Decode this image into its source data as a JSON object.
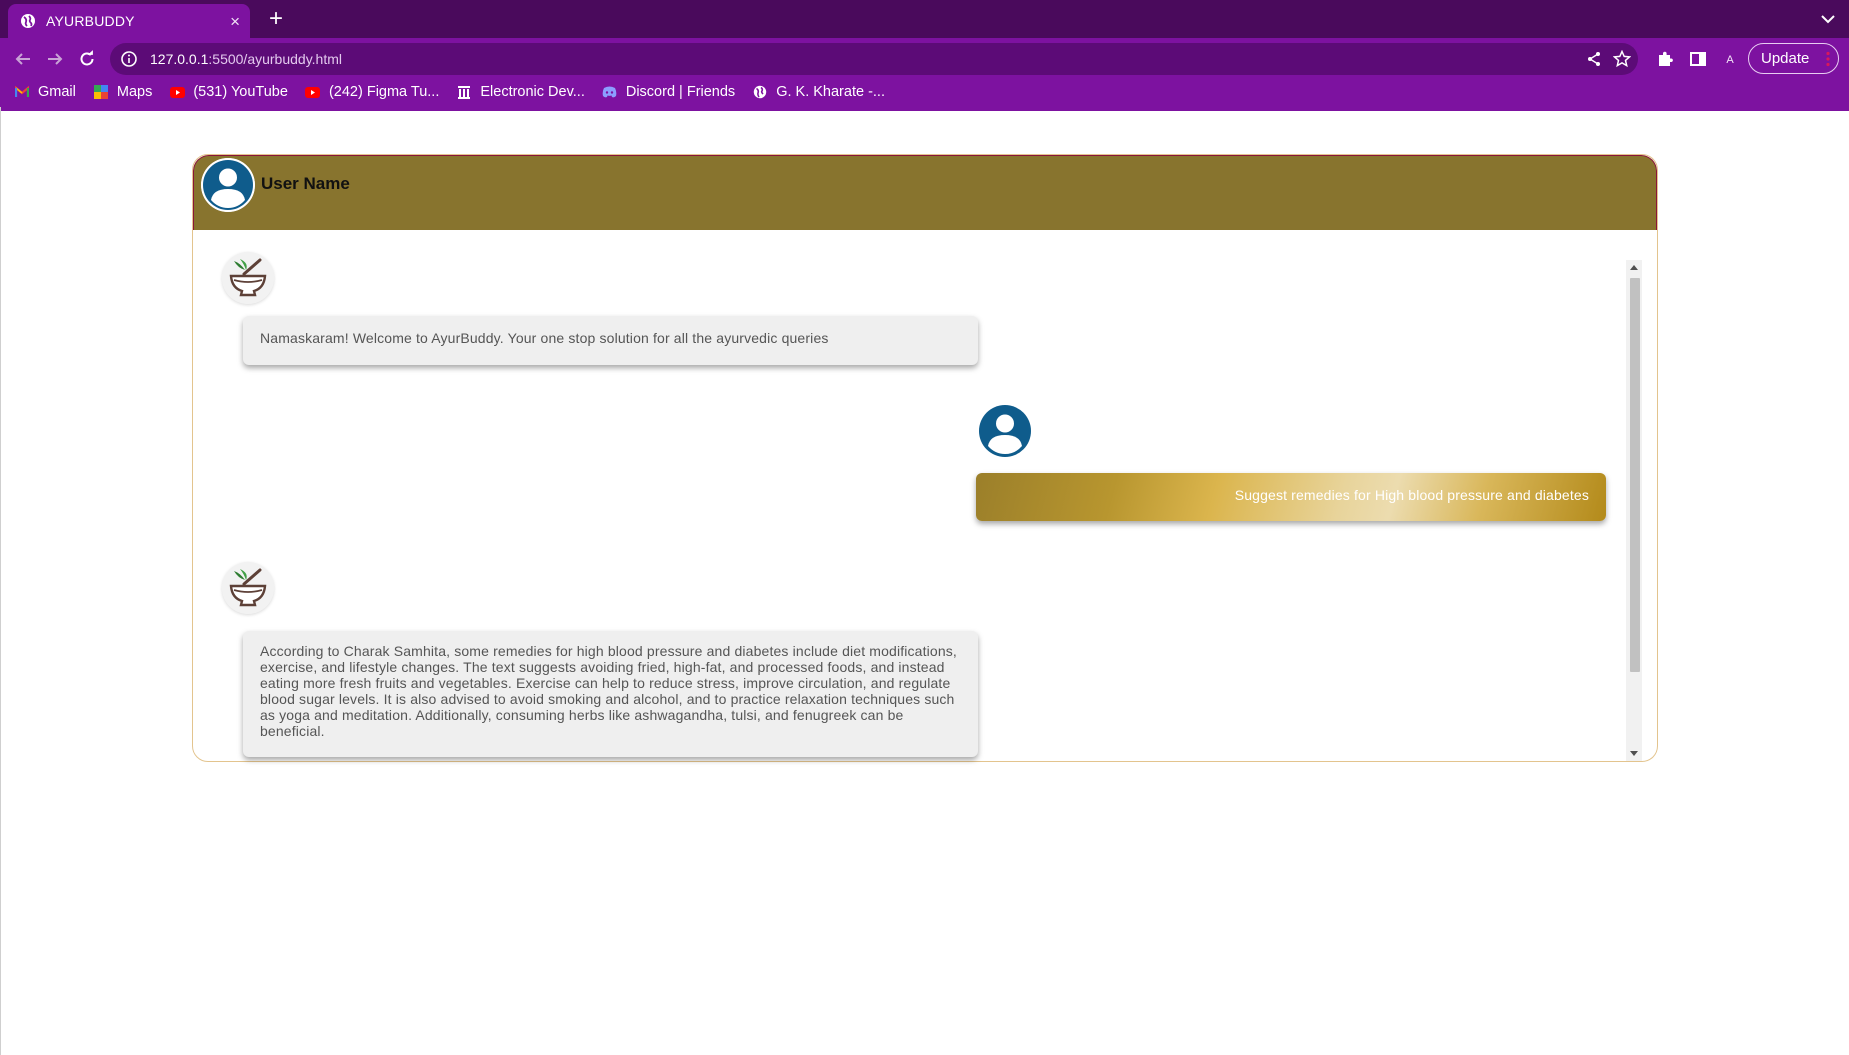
{
  "browser": {
    "tab": {
      "title": "AYURBUDDY",
      "icon": "globe-icon",
      "close_label": "×"
    },
    "new_tab_label": "+",
    "address": {
      "host": "127.0.0.1",
      "path": ":5500/ayurbuddy.html"
    },
    "profile_initial": "A",
    "update_label": "Update",
    "bookmarks": [
      {
        "label": "Gmail",
        "icon": "gmail-icon"
      },
      {
        "label": "Maps",
        "icon": "maps-icon"
      },
      {
        "label": "(531) YouTube",
        "icon": "youtube-icon"
      },
      {
        "label": "(242) Figma Tu...",
        "icon": "youtube-icon"
      },
      {
        "label": "Electronic Dev...",
        "icon": "building-icon"
      },
      {
        "label": "Discord | Friends",
        "icon": "discord-icon"
      },
      {
        "label": "G. K. Kharate -...",
        "icon": "globe-icon"
      }
    ],
    "colors": {
      "tabbar": "#4a0a5c",
      "toolbar": "#7d12a0",
      "omnibox": "#5c0b77"
    }
  },
  "chat": {
    "header": {
      "user_name": "User Name",
      "avatar_icon": "user-avatar-icon",
      "bg_color": "#88742e"
    },
    "messages": [
      {
        "sender": "bot",
        "icon": "mortar-pestle-logo",
        "text": "Namaskaram! Welcome to AyurBuddy. Your one stop solution for all the ayurvedic queries"
      },
      {
        "sender": "user",
        "icon": "user-avatar-icon",
        "text": "Suggest remedies for High blood pressure and diabetes"
      },
      {
        "sender": "bot",
        "icon": "mortar-pestle-logo",
        "text": "According to Charak Samhita, some remedies for high blood pressure and diabetes include diet modifications, exercise, and lifestyle changes. The text suggests avoiding fried, high-fat, and processed foods, and instead eating more fresh fruits and vegetables. Exercise can help to reduce stress, improve circulation, and regulate blood sugar levels. It is also advised to avoid smoking and alcohol, and to practice relaxation techniques such as yoga and meditation. Additionally, consuming herbs like ashwagandha, tulsi, and fenugreek can be beneficial."
      }
    ],
    "colors": {
      "bubble_bot": "#efefef",
      "bubble_user_gold": "#c9a33e",
      "accent_border": "#e3c48e",
      "avatar_blue": "#0f5c8c"
    }
  }
}
